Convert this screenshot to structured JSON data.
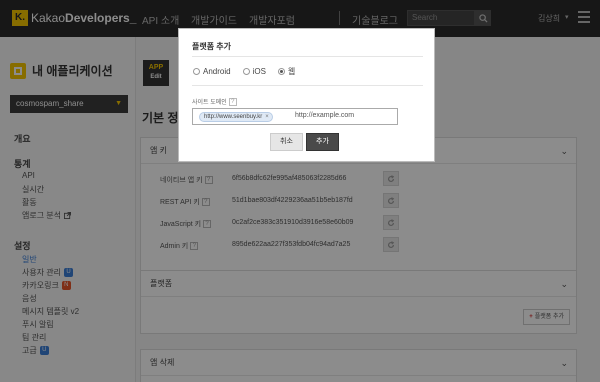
{
  "topbar": {
    "logo_mark": "K.",
    "logo_brand_light": "Kakao",
    "logo_brand_bold": "Developers_",
    "nav": [
      {
        "label": "API 소개"
      },
      {
        "label": "개발가이드"
      },
      {
        "label": "개발자포럼"
      },
      {
        "label": "기술블로그"
      }
    ],
    "search_placeholder": "Search",
    "user_name": "김상희",
    "search_icon": "search-icon",
    "menu_icon": "hamburger-icon"
  },
  "sidebar": {
    "my_apps_label": "내 애플리케이션",
    "app_select_value": "cosmospam_share",
    "sections": [
      {
        "title": "개요",
        "items": []
      },
      {
        "title": "통계",
        "items": [
          {
            "label": "API",
            "badge": "",
            "active": false
          },
          {
            "label": "실시간",
            "badge": "",
            "active": false
          },
          {
            "label": "활동",
            "badge": "",
            "active": false
          },
          {
            "label": "앱로그 분석",
            "badge": "",
            "active": false,
            "external": true
          }
        ]
      },
      {
        "title": "설정",
        "items": [
          {
            "label": "일반",
            "badge": "",
            "active": true
          },
          {
            "label": "사용자 관리",
            "badge": "U",
            "badge_color": "blue",
            "active": false
          },
          {
            "label": "카카오링크",
            "badge": "N",
            "badge_color": "orange",
            "active": false
          },
          {
            "label": "음성",
            "badge": "",
            "active": false
          },
          {
            "label": "메시지 템플릿 v2",
            "badge": "",
            "active": false
          },
          {
            "label": "푸시 알림",
            "badge": "",
            "active": false
          },
          {
            "label": "팀 관리",
            "badge": "",
            "active": false
          },
          {
            "label": "고급",
            "badge": "U",
            "badge_color": "blue",
            "active": false
          }
        ]
      }
    ]
  },
  "main": {
    "app_thumb_top": "APP",
    "app_thumb_bottom": "Edit",
    "section_title": "기본 정보",
    "app_keys_title": "앱 키",
    "keys": [
      {
        "label": "네이티브 앱 키",
        "value": "6f56b8dfc62fe995af485063f2285d66"
      },
      {
        "label": "REST API 키",
        "value": "51d1bae803df4229236aa51b5eb187fd"
      },
      {
        "label": "JavaScript 키",
        "value": "0c2af2ce383c351910d3916e58e60b09"
      },
      {
        "label": "Admin 키",
        "value": "895de622aa227f353fdb04fc94ad7a25"
      }
    ],
    "platform_title": "플랫폼",
    "add_platform_label": "플랫폼 추가",
    "delete_app_title": "앱 삭제",
    "help_mark": "?",
    "chevron": "⌄"
  },
  "modal": {
    "title": "플랫폼 추가",
    "options": [
      {
        "label": "Android",
        "checked": false
      },
      {
        "label": "iOS",
        "checked": false
      },
      {
        "label": "웹",
        "checked": true
      }
    ],
    "domain_label": "사이트 도메인",
    "domain_tag": "http://www.seenbuy.kr",
    "domain_input_placeholder": "http://example.com",
    "cancel_label": "취소",
    "add_label": "추가"
  },
  "colors": {
    "topbar_bg": "#2b2b2b",
    "brand_yellow": "#f6c700",
    "active_link": "#3b7ed8",
    "badge_orange": "#e8562a",
    "primary_button": "#4a4a4a"
  }
}
